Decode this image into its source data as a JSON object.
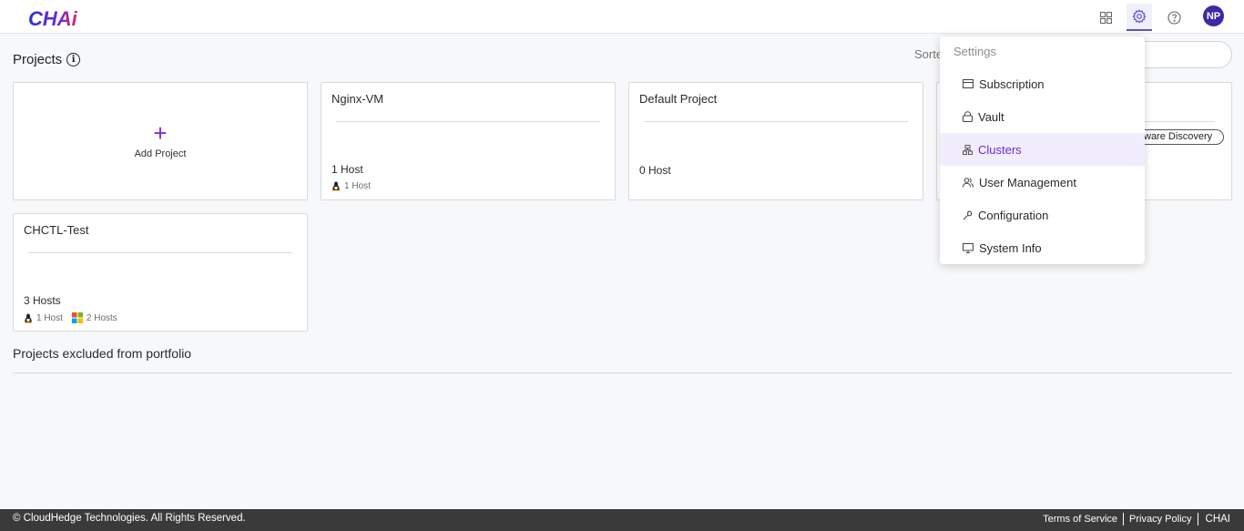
{
  "header": {
    "logo_text": "CHAi",
    "icons": [
      "grid-icon",
      "gear-icon",
      "help-icon"
    ],
    "avatar_initials": "NP",
    "accent_color": "#5b4fd6"
  },
  "projects": {
    "title": "Projects",
    "info_glyph": "i",
    "sort_label": "Sorte",
    "add_project_label": "Add Project",
    "cards": [
      {
        "name": "Nginx-VM",
        "hosts": "1 Host",
        "os": [
          {
            "icon": "linux-icon",
            "label": "1 Host"
          }
        ]
      },
      {
        "name": "Default Project",
        "hosts": "0 Host",
        "os": []
      },
      {
        "name": "CHCTL-Test",
        "hosts": "3 Hosts",
        "os": [
          {
            "icon": "linux-icon",
            "label": "1 Host"
          },
          {
            "icon": "windows-icon",
            "label": "2 Hosts"
          }
        ]
      }
    ],
    "partial_tag": "ware Discovery"
  },
  "excluded": {
    "title": "Projects excluded from portfolio"
  },
  "settings_menu": {
    "header": "Settings",
    "items": [
      {
        "label": "Subscription",
        "icon": "credit-card-icon"
      },
      {
        "label": "Vault",
        "icon": "lock-icon"
      },
      {
        "label": "Clusters",
        "icon": "cluster-icon",
        "active": true
      },
      {
        "label": "User Management",
        "icon": "users-icon"
      },
      {
        "label": "Configuration",
        "icon": "wrench-icon"
      },
      {
        "label": "System Info",
        "icon": "monitor-icon"
      }
    ],
    "active_color": "#6b2bd9"
  },
  "footer": {
    "copyright": "© CloudHedge Technologies. All Rights Reserved.",
    "links": [
      "Terms of Service",
      "Privacy Policy"
    ],
    "brand": "CHAI"
  }
}
